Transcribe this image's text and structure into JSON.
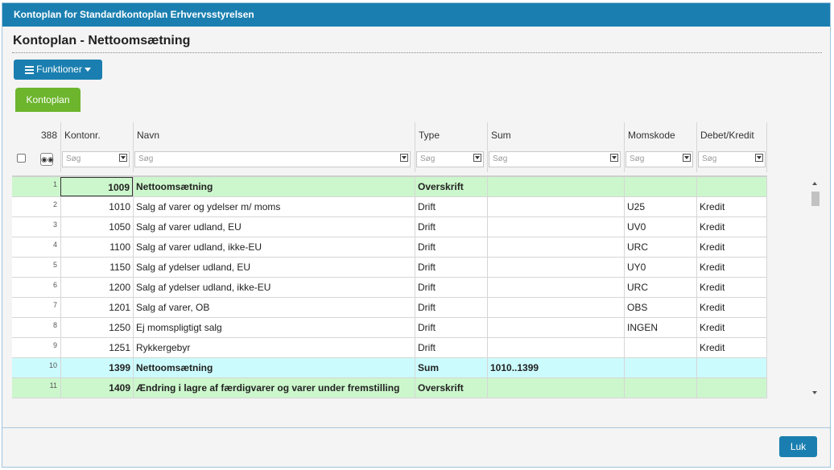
{
  "dialog": {
    "title": "Kontoplan for Standardkontoplan Erhvervsstyrelsen"
  },
  "page": {
    "title": "Kontoplan - Nettoomsætning"
  },
  "toolbar": {
    "functions_label": "Funktioner"
  },
  "tabs": [
    {
      "label": "Kontoplan"
    }
  ],
  "grid": {
    "row_count": "388",
    "columns": [
      {
        "label": "Kontonr."
      },
      {
        "label": "Navn"
      },
      {
        "label": "Type"
      },
      {
        "label": "Sum"
      },
      {
        "label": "Momskode"
      },
      {
        "label": "Debet/Kredit"
      }
    ],
    "filter_placeholder": "Søg",
    "rows": [
      {
        "idx": "1",
        "knr": "1009",
        "navn": "Nettoomsætning",
        "type": "Overskrift",
        "sum": "",
        "moms": "",
        "dk": ""
      },
      {
        "idx": "2",
        "knr": "1010",
        "navn": "Salg af varer og ydelser m/ moms",
        "type": "Drift",
        "sum": "",
        "moms": "U25",
        "dk": "Kredit"
      },
      {
        "idx": "3",
        "knr": "1050",
        "navn": "Salg af varer udland, EU",
        "type": "Drift",
        "sum": "",
        "moms": "UV0",
        "dk": "Kredit"
      },
      {
        "idx": "4",
        "knr": "1100",
        "navn": "Salg af varer udland, ikke-EU",
        "type": "Drift",
        "sum": "",
        "moms": "URC",
        "dk": "Kredit"
      },
      {
        "idx": "5",
        "knr": "1150",
        "navn": "Salg af ydelser udland, EU",
        "type": "Drift",
        "sum": "",
        "moms": "UY0",
        "dk": "Kredit"
      },
      {
        "idx": "6",
        "knr": "1200",
        "navn": "Salg af ydelser udland, ikke-EU",
        "type": "Drift",
        "sum": "",
        "moms": "URC",
        "dk": "Kredit"
      },
      {
        "idx": "7",
        "knr": "1201",
        "navn": "Salg af varer, OB",
        "type": "Drift",
        "sum": "",
        "moms": "OBS",
        "dk": "Kredit"
      },
      {
        "idx": "8",
        "knr": "1250",
        "navn": "Ej momspligtigt salg",
        "type": "Drift",
        "sum": "",
        "moms": "INGEN",
        "dk": "Kredit"
      },
      {
        "idx": "9",
        "knr": "1251",
        "navn": "Rykkergebyr",
        "type": "Drift",
        "sum": "",
        "moms": "",
        "dk": "Kredit"
      },
      {
        "idx": "10",
        "knr": "1399",
        "navn": "Nettoomsætning",
        "type": "Sum",
        "sum": "1010..1399",
        "moms": "",
        "dk": ""
      },
      {
        "idx": "11",
        "knr": "1409",
        "navn": "Ændring i lagre af færdigvarer og varer under fremstilling",
        "type": "Overskrift",
        "sum": "",
        "moms": "",
        "dk": ""
      }
    ]
  },
  "footer": {
    "close_label": "Luk"
  }
}
